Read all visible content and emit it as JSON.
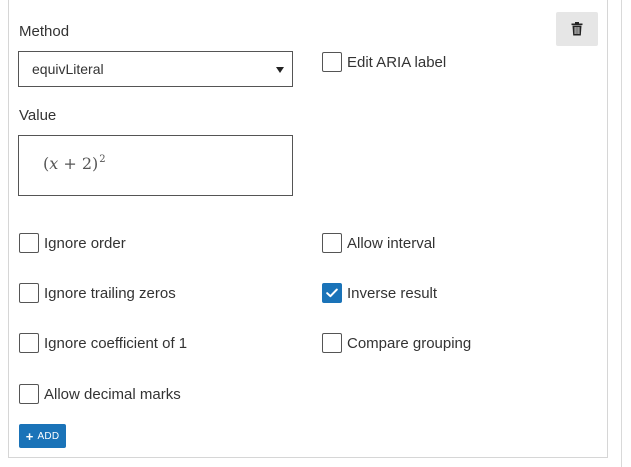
{
  "method": {
    "label": "Method",
    "selected": "equivLiteral"
  },
  "value": {
    "label": "Value",
    "expression": {
      "open": "(",
      "var": "x",
      "op": " + ",
      "num": "2",
      "close": ")",
      "exp": "2"
    }
  },
  "edit_aria": {
    "label": "Edit ARIA label",
    "checked": false
  },
  "options": {
    "ignore_order": {
      "label": "Ignore order",
      "checked": false
    },
    "allow_interval": {
      "label": "Allow interval",
      "checked": false
    },
    "ignore_trailing_zeros": {
      "label": "Ignore trailing zeros",
      "checked": false
    },
    "inverse_result": {
      "label": "Inverse result",
      "checked": true
    },
    "ignore_coefficient": {
      "label": "Ignore coefficient of 1",
      "checked": false
    },
    "compare_grouping": {
      "label": "Compare grouping",
      "checked": false
    },
    "allow_decimal_marks": {
      "label": "Allow decimal marks",
      "checked": false
    }
  },
  "add_button": {
    "label": "ADD"
  },
  "icons": {
    "delete": "trash-icon",
    "add": "plus-icon",
    "dropdown": "caret-down-icon",
    "check": "check-icon"
  },
  "colors": {
    "accent": "#1a73b8",
    "delete_bg": "#e6e6e6"
  }
}
